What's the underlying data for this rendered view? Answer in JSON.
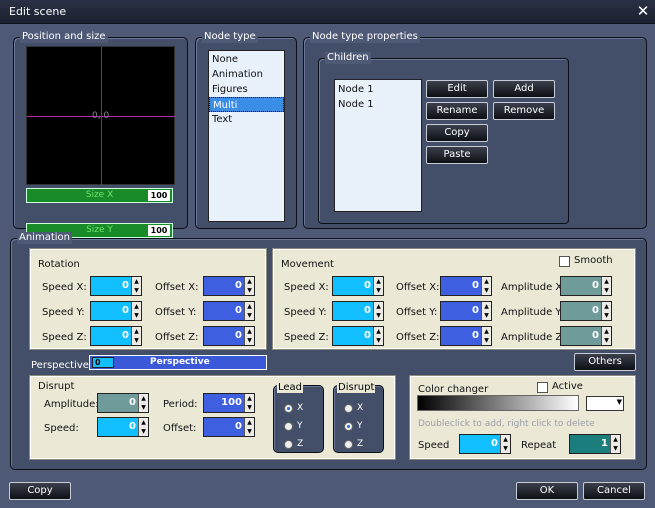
{
  "window": {
    "title": "Edit scene"
  },
  "position": {
    "title": "Position and size",
    "coord": "0, 0",
    "size_x_label": "Size X",
    "size_x_value": "100",
    "size_y_label": "Size Y",
    "size_y_value": "100"
  },
  "node_type": {
    "title": "Node type",
    "items": [
      "None",
      "Animation",
      "Figures",
      "Multi",
      "Text"
    ],
    "selected": "Multi"
  },
  "node_props": {
    "title": "Node type properties",
    "children_title": "Children",
    "children": [
      "Node 1",
      "Node 1"
    ],
    "buttons": {
      "edit": "Edit",
      "add": "Add",
      "rename": "Rename",
      "remove": "Remove",
      "copy": "Copy",
      "paste": "Paste"
    }
  },
  "animation": {
    "title": "Animation",
    "rotation": {
      "title": "Rotation",
      "speed_x": "Speed X:",
      "speed_y": "Speed Y:",
      "speed_z": "Speed Z:",
      "offset_x": "Offset X:",
      "offset_y": "Offset Y:",
      "offset_z": "Offset Z:",
      "speed_x_v": "0",
      "speed_y_v": "0",
      "speed_z_v": "0",
      "offset_x_v": "0",
      "offset_y_v": "0",
      "offset_z_v": "0"
    },
    "movement": {
      "title": "Movement",
      "smooth": "Smooth",
      "speed_x": "Speed X:",
      "speed_y": "Speed Y:",
      "speed_z": "Speed Z:",
      "offset_x": "Offset X:",
      "offset_y": "Offset Y:",
      "offset_z": "Offset Z:",
      "amp_x": "Amplitude X:",
      "amp_y": "Amplitude Y:",
      "amp_z": "Amplitude Z:",
      "speed_x_v": "0",
      "speed_y_v": "0",
      "speed_z_v": "0",
      "offset_x_v": "0",
      "offset_y_v": "0",
      "offset_z_v": "0",
      "amp_x_v": "0",
      "amp_y_v": "0",
      "amp_z_v": "0"
    },
    "perspective": {
      "label": "Perspective:",
      "bar_label": "Perspective",
      "value": "0"
    },
    "others": "Others",
    "disrupt": {
      "title": "Disrupt",
      "amplitude": "Amplitude:",
      "speed": "Speed:",
      "period": "Period:",
      "offset": "Offset:",
      "amplitude_v": "0",
      "speed_v": "0",
      "period_v": "100",
      "offset_v": "0",
      "lead": {
        "title": "Lead",
        "x": "X",
        "y": "Y",
        "z": "Z",
        "selected": "X"
      },
      "disrupt_axis": {
        "title": "Disrupt",
        "x": "X",
        "y": "Y",
        "z": "Z",
        "selected": "Y"
      }
    },
    "color_changer": {
      "title": "Color changer",
      "active": "Active",
      "hint": "Doubleclick to add, right click to delete",
      "speed": "Speed",
      "repeat": "Repeat",
      "speed_v": "0",
      "repeat_v": "1"
    }
  },
  "footer": {
    "copy": "Copy",
    "ok": "OK",
    "cancel": "Cancel"
  }
}
